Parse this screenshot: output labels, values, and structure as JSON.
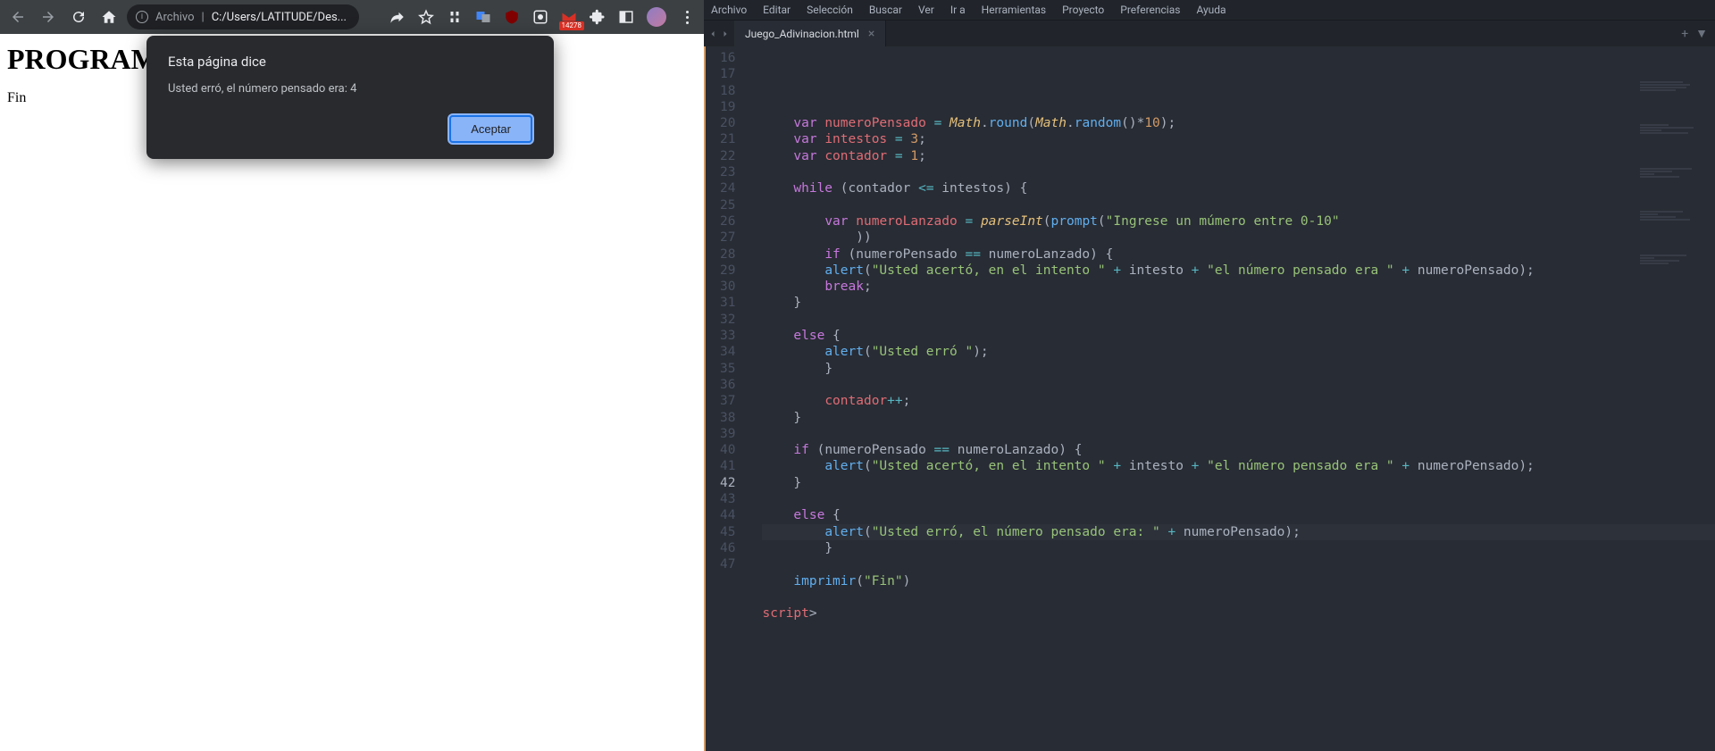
{
  "browser": {
    "url_scheme": "Archivo",
    "url_path": "C:/Users/LATITUDE/Des...",
    "gmail_badge": "14278"
  },
  "page": {
    "heading": "PROGRAM",
    "body": "Fin"
  },
  "dialog": {
    "title": "Esta página dice",
    "message": "Usted erró, el número pensado era: 4",
    "accept": "Aceptar"
  },
  "editor": {
    "menus": [
      "Archivo",
      "Editar",
      "Selección",
      "Buscar",
      "Ver",
      "Ir a",
      "Herramientas",
      "Proyecto",
      "Preferencias",
      "Ayuda"
    ],
    "tab_name": "Juego_Adivinacion.html",
    "line_start": 16,
    "line_end": 47,
    "highlight_line": 42,
    "code": {
      "l17": {
        "a": "var",
        "b": "numeroPensado",
        "c": "=",
        "d": "Math",
        "e": ".",
        "f": "round",
        "g": "(",
        "h": "Math",
        "i": ".",
        "j": "random",
        "k": "()*",
        "l": "10",
        "m": ");"
      },
      "l18": {
        "a": "var",
        "b": "intestos",
        "c": "=",
        "d": "3",
        "e": ";"
      },
      "l19": {
        "a": "var",
        "b": "contador",
        "c": "=",
        "d": "1",
        "e": ";"
      },
      "l21": {
        "a": "while",
        "b": "(contador",
        "c": "<=",
        "d": "intestos) {"
      },
      "l23": {
        "a": "var",
        "b": "numeroLanzado",
        "c": "=",
        "d": "parseInt",
        "e": "(",
        "f": "prompt",
        "g": "(",
        "h": "\"Ingrese un múmero entre 0-10\""
      },
      "l23b": {
        "a": "))"
      },
      "l25": {
        "a": "if",
        "b": "(numeroPensado",
        "c": "==",
        "d": "numeroLanzado) {"
      },
      "l26": {
        "a": "alert",
        "b": "(",
        "c": "\"Usted acertó, en el intento \"",
        "d": "+",
        "e": "intesto",
        "f": "+",
        "g": "\"el número pensado era \"",
        "h": "+",
        "i": "numeroPensado);"
      },
      "l27": {
        "a": "break",
        "b": ";"
      },
      "l28": {
        "a": "}"
      },
      "l30": {
        "a": "else",
        "b": "{"
      },
      "l31": {
        "a": "alert",
        "b": "(",
        "c": "\"Usted erró \"",
        "d": ");"
      },
      "l32": {
        "a": "}"
      },
      "l34": {
        "a": "contador",
        "b": "++",
        "c": ";"
      },
      "l35": {
        "a": "}"
      },
      "l37": {
        "a": "if",
        "b": "(numeroPensado",
        "c": "==",
        "d": "numeroLanzado) {"
      },
      "l38": {
        "a": "alert",
        "b": "(",
        "c": "\"Usted acertó, en el intento \"",
        "d": "+",
        "e": "intesto",
        "f": "+",
        "g": "\"el número pensado era \"",
        "h": "+",
        "i": "numeroPensado);"
      },
      "l39": {
        "a": "}"
      },
      "l41": {
        "a": "else",
        "b": "{"
      },
      "l42": {
        "a": "alert",
        "b": "(",
        "c": "\"Usted erró, el número pensado era: \"",
        "d": "+",
        "e": "numeroPensado);"
      },
      "l43": {
        "a": "}"
      },
      "l45": {
        "a": "imprimir",
        "b": "(",
        "c": "\"Fin\"",
        "d": ")"
      },
      "l47": {
        "a": "</",
        "b": "script",
        "c": ">"
      }
    }
  }
}
